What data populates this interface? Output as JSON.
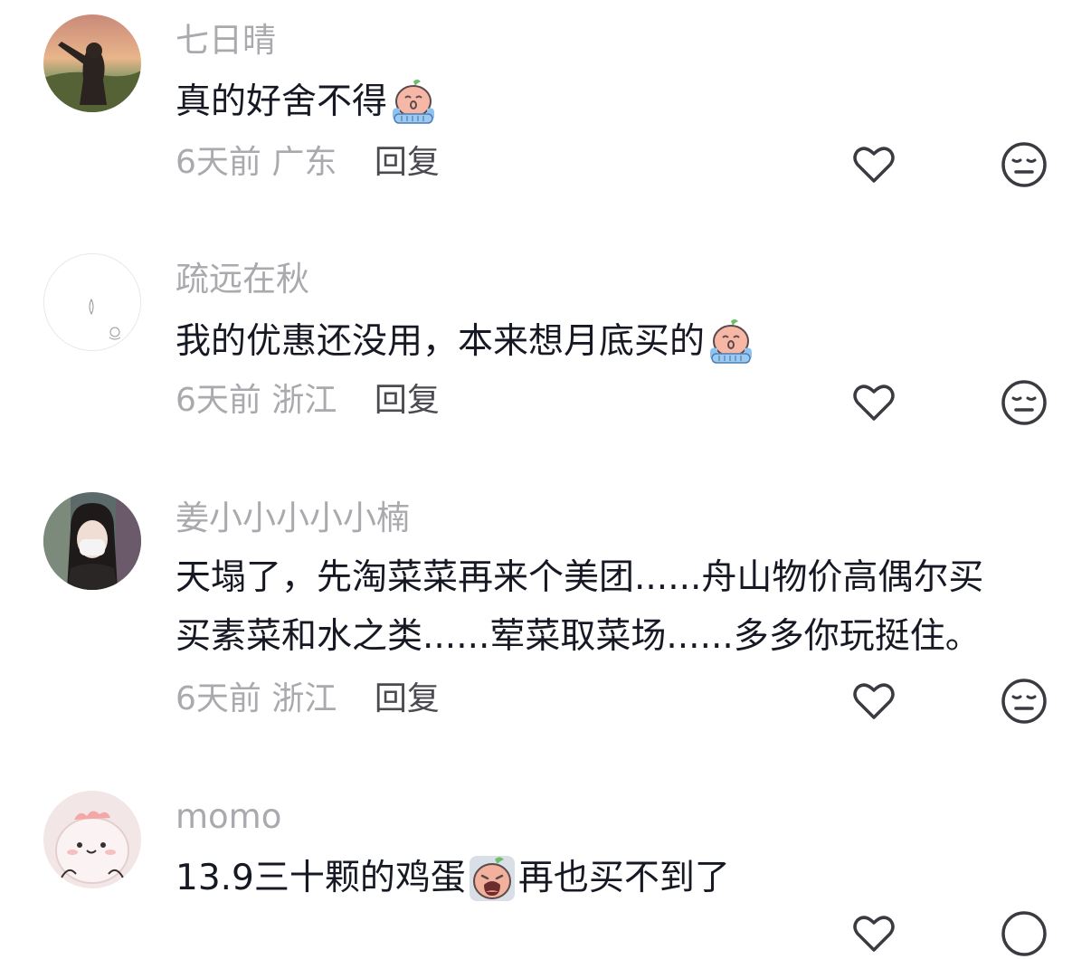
{
  "comments": [
    {
      "username": "七日晴",
      "text_parts": [
        "真的好舍不得"
      ],
      "emoji": "crying-peach-emoji",
      "time": "6天前",
      "location": "广东",
      "reply_label": "回复",
      "like_icon": "heart-outline-icon",
      "dislike_icon": "unamused-face-icon"
    },
    {
      "username": "疏远在秋",
      "text_parts": [
        "我的优惠还没用，本来想月底买的"
      ],
      "emoji": "crying-peach-emoji",
      "time": "6天前",
      "location": "浙江",
      "reply_label": "回复",
      "like_icon": "heart-outline-icon",
      "dislike_icon": "unamused-face-icon"
    },
    {
      "username": "姜小小小小小楠",
      "text_line1": "天塌了，先淘菜菜再来个美团......舟山物价高偶尔买",
      "text_line2": "买素菜和水之类......荤菜取菜场......多多你玩挺住。",
      "time": "6天前",
      "location": "浙江",
      "reply_label": "回复",
      "like_icon": "heart-outline-icon",
      "dislike_icon": "unamused-face-icon"
    },
    {
      "username": "momo",
      "text_before": "13.9三十颗的鸡蛋",
      "emoji": "wailing-peach-emoji",
      "text_after": "再也买不到了"
    }
  ],
  "colors": {
    "username": "#a9a9ae",
    "body_text": "#161823",
    "meta_text": "#a9a9ae",
    "reply_text": "#4a4a50",
    "icon_stroke": "#3a3a40"
  }
}
